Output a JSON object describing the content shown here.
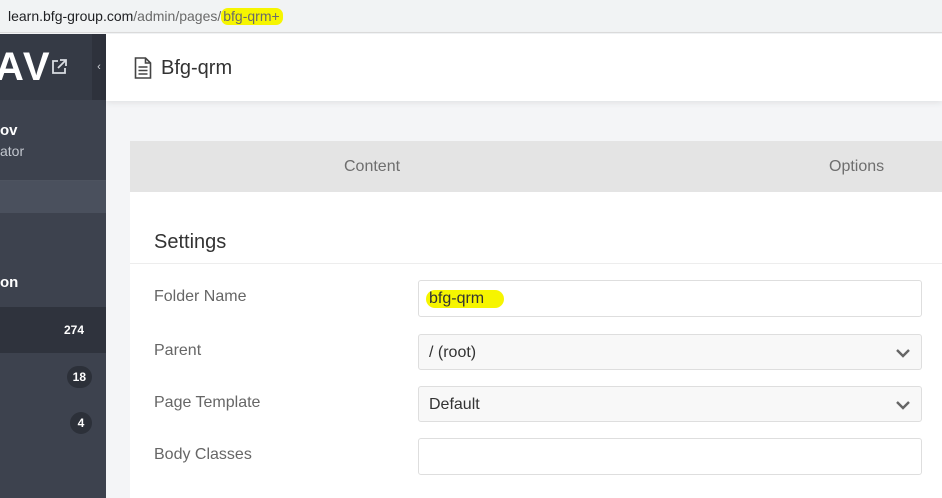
{
  "browser": {
    "url_host": "learn.bfg-group.com",
    "url_path": "/admin/pages/",
    "url_highlight": "bfg-qrm+"
  },
  "sidebar": {
    "logo_text": "AV",
    "collapse_glyph": "‹",
    "user_name": "ov",
    "user_role": "ator",
    "section_label": "on",
    "items": [
      {
        "badge": "274"
      },
      {
        "badge": "18"
      },
      {
        "badge": "4"
      }
    ]
  },
  "header": {
    "title": "Bfg-qrm",
    "icon": "document-icon"
  },
  "tabs": {
    "content": "Content",
    "options": "Options"
  },
  "settings": {
    "title": "Settings",
    "folder_name_label": "Folder Name",
    "folder_name_value": "bfg-qrm",
    "parent_label": "Parent",
    "parent_value": "/ (root)",
    "template_label": "Page Template",
    "template_value": "Default",
    "body_classes_label": "Body Classes",
    "body_classes_value": ""
  },
  "colors": {
    "highlight": "#f6f500",
    "sidebar": "#3d424e",
    "tab_bar": "#e4e4e4"
  }
}
